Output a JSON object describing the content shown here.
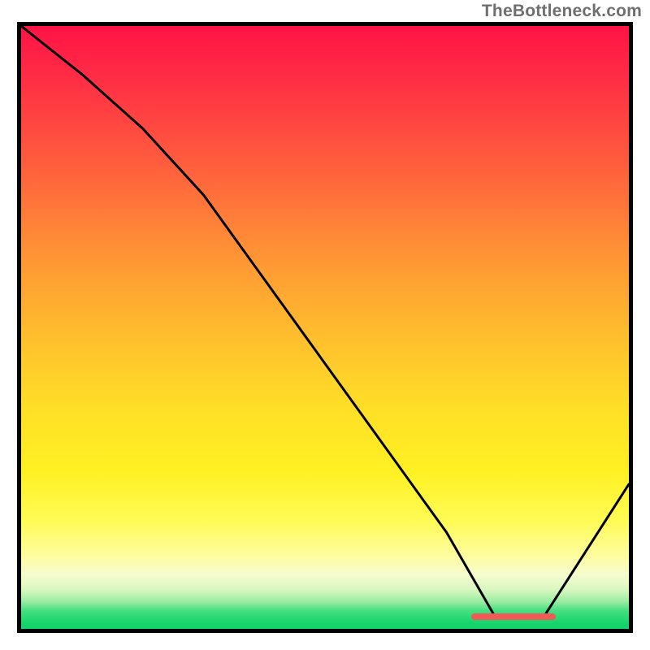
{
  "watermark": "TheBottleneck.com",
  "colors": {
    "curve": "#000000",
    "plateau_marker": "#f05a56",
    "border": "#000000"
  },
  "plot": {
    "inner_width": 748,
    "inner_height": 742
  },
  "chart_data": {
    "type": "line",
    "title": "",
    "xlabel": "",
    "ylabel": "",
    "xlim": [
      0,
      100
    ],
    "ylim": [
      0,
      100
    ],
    "x": [
      0,
      10,
      20,
      30,
      40,
      50,
      60,
      70,
      78,
      86,
      100
    ],
    "values": [
      100,
      92,
      83,
      72,
      58,
      44,
      30,
      16,
      2,
      2,
      24
    ],
    "plateau": {
      "x_start": 74,
      "x_end": 88,
      "y": 2
    }
  }
}
